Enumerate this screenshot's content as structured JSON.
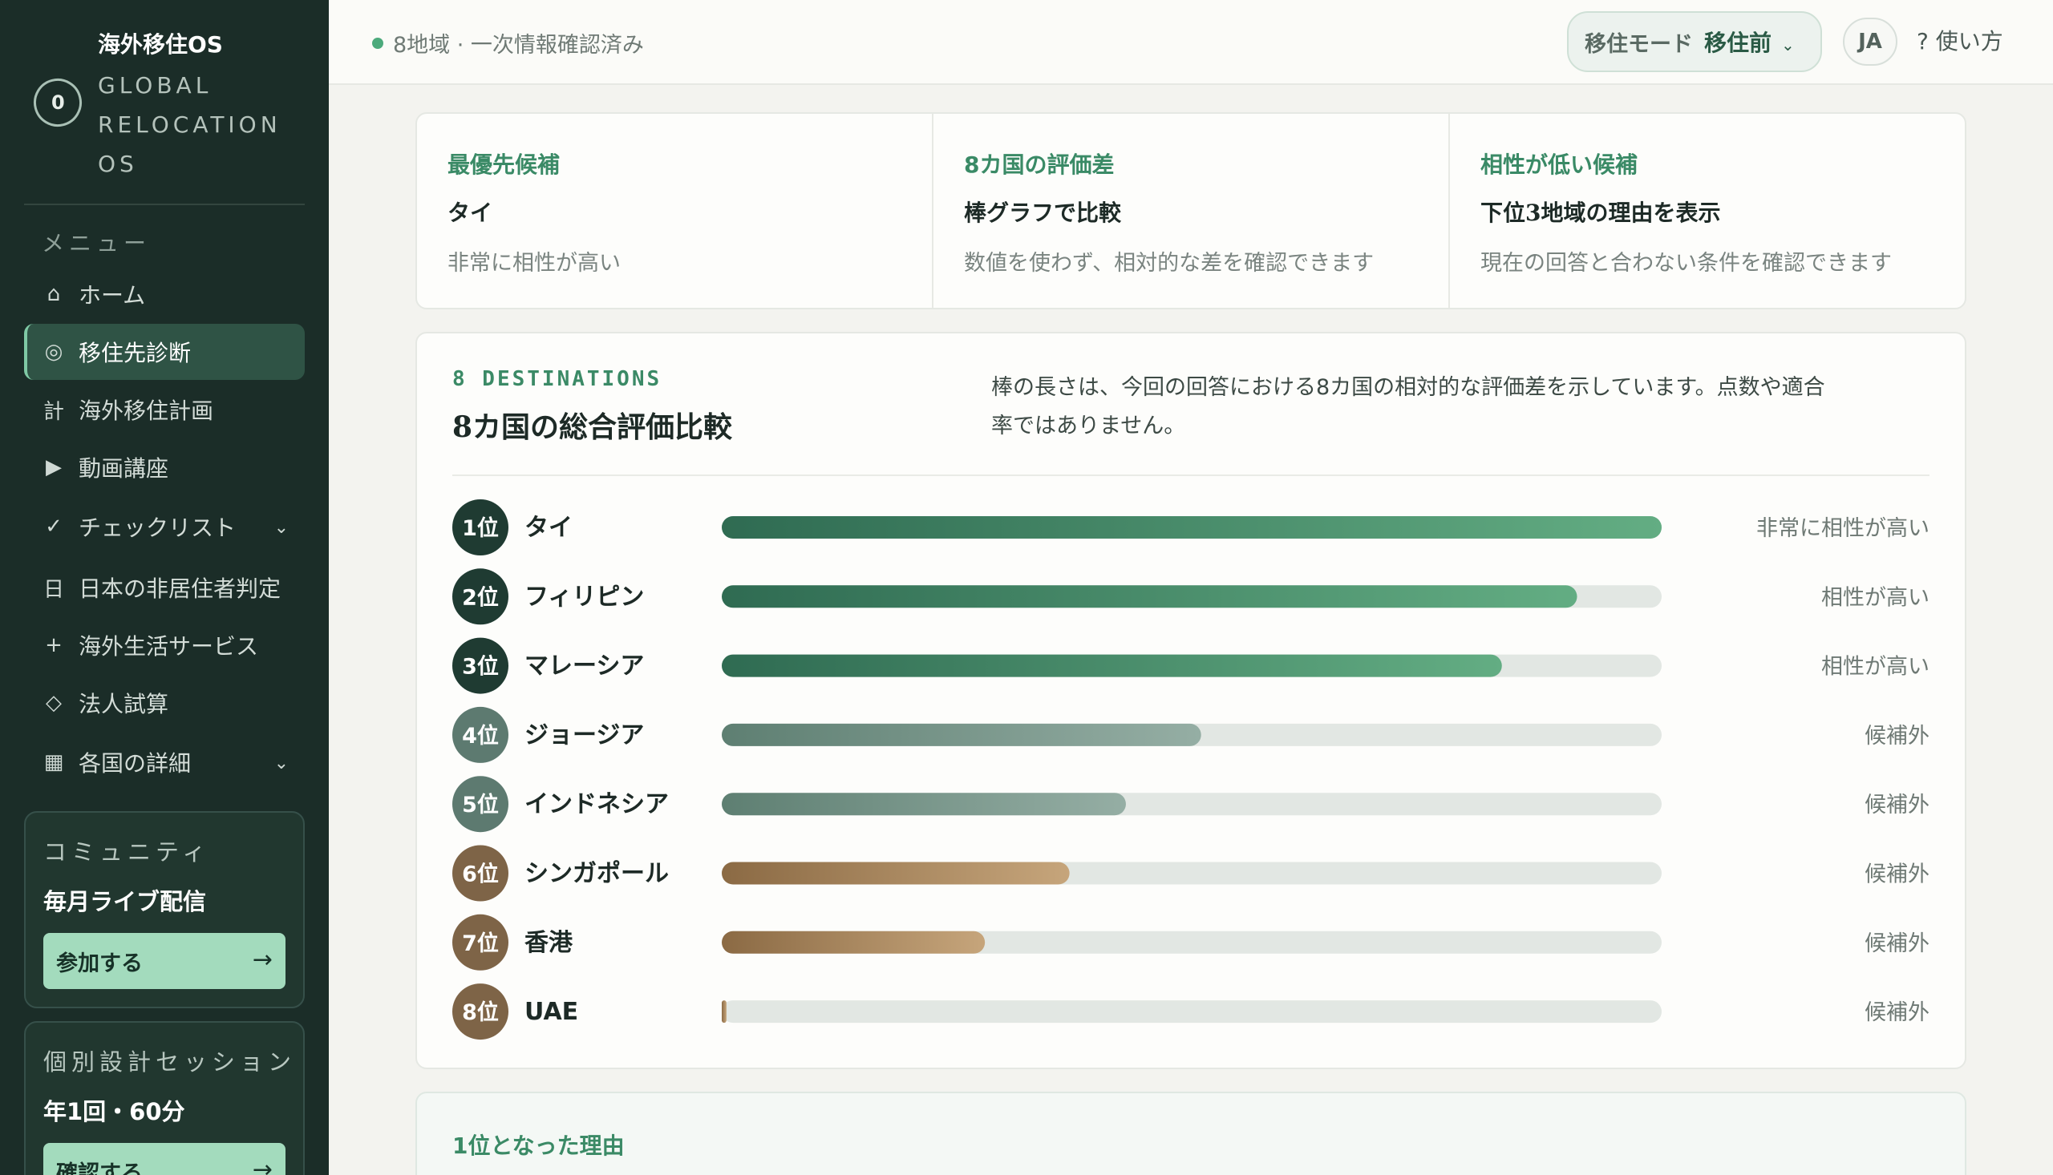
{
  "sidebar": {
    "brand_name": "海外移住OS",
    "brand_logo": "0",
    "brand_sub": "GLOBAL RELOCATION OS",
    "menu_heading": "メニュー",
    "items": [
      {
        "icon": "⌂",
        "icon_name": "home-icon",
        "label": "ホーム",
        "chevron": false
      },
      {
        "icon": "◎",
        "icon_name": "target-icon",
        "label": "移住先診断",
        "chevron": false,
        "active": true
      },
      {
        "icon": "計",
        "icon_name": "plan-icon",
        "label": "海外移住計画",
        "chevron": false
      },
      {
        "icon": "▶",
        "icon_name": "play-icon",
        "label": "動画講座",
        "chevron": false
      },
      {
        "icon": "✓",
        "icon_name": "check-icon",
        "label": "チェックリスト",
        "chevron": true
      },
      {
        "icon": "日",
        "icon_name": "japan-icon",
        "label": "日本の非居住者判定",
        "chevron": false
      },
      {
        "icon": "+",
        "icon_name": "plus-icon",
        "label": "海外生活サービス",
        "chevron": false
      },
      {
        "icon": "◇",
        "icon_name": "diamond-icon",
        "label": "法人試算",
        "chevron": false
      },
      {
        "icon": "▦",
        "icon_name": "grid-icon",
        "label": "各国の詳細",
        "chevron": true
      }
    ],
    "community": {
      "heading": "コミュニティ",
      "title": "毎月ライブ配信",
      "button": "参加する",
      "arrow": "→"
    },
    "session": {
      "heading": "個別設計セッション",
      "title": "年1回・60分",
      "button": "確認する",
      "arrow": "→"
    }
  },
  "topbar": {
    "status": "8地域 · 一次情報確認済み",
    "mode_label": "移住モード",
    "mode_value": "移住前",
    "mode_chevron": "⌄",
    "lang": "JA",
    "help": "? 使い方"
  },
  "summary": [
    {
      "head": "最優先候補",
      "title": "タイ",
      "sub": "非常に相性が高い"
    },
    {
      "head": "8カ国の評価差",
      "title": "棒グラフで比較",
      "sub": "数値を使わず、相対的な差を確認できます"
    },
    {
      "head": "相性が低い候補",
      "title": "下位3地域の理由を表示",
      "sub": "現在の回答と合わない条件を確認できます"
    }
  ],
  "panel": {
    "eyebrow": "8 DESTINATIONS",
    "title": "8カ国の総合評価比較",
    "description": "棒の長さは、今回の回答における8カ国の相対的な評価差を示しています。点数や適合率ではありません。"
  },
  "chart_data": {
    "type": "bar",
    "orientation": "horizontal",
    "title": "8カ国の総合評価比較",
    "categories": [
      "タイ",
      "フィリピン",
      "マレーシア",
      "ジョージア",
      "インドネシア",
      "シンガポール",
      "香港",
      "UAE"
    ],
    "ranks": [
      "1位",
      "2位",
      "3位",
      "4位",
      "5位",
      "6位",
      "7位",
      "8位"
    ],
    "values": [
      1.0,
      0.91,
      0.83,
      0.51,
      0.43,
      0.37,
      0.28,
      0.005
    ],
    "labels": [
      "非常に相性が高い",
      "相性が高い",
      "相性が高い",
      "候補外",
      "候補外",
      "候補外",
      "候補外",
      "候補外"
    ],
    "xlim": [
      0,
      1
    ],
    "tiers": [
      "high",
      "high",
      "high",
      "mid",
      "mid",
      "low",
      "low",
      "low"
    ],
    "colors": {
      "high": [
        "#2f6b52",
        "#63ad83"
      ],
      "mid": [
        "#5e7f72",
        "#95aea4"
      ],
      "low": [
        "#8b6a44",
        "#c6a57b"
      ],
      "track": "#e2e7e3",
      "badge_high": "#1f3b32",
      "badge_mid": "#5d7a70",
      "badge_low": "#7e6447"
    }
  },
  "reason": {
    "title": "1位となった理由"
  }
}
